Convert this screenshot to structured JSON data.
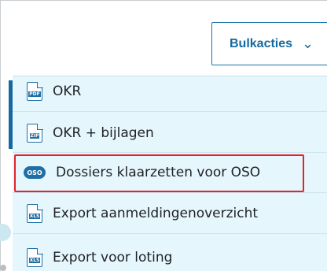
{
  "toolbar": {
    "bulk_actions_label": "Bulkacties",
    "bulk_actions_chevron": "chevron-down-icon"
  },
  "menu": {
    "items": [
      {
        "label": "OKR",
        "icon": "pdf-file-icon",
        "icon_tag": "PDF"
      },
      {
        "label": "OKR + bijlagen",
        "icon": "zip-file-icon",
        "icon_tag": "ZIP"
      },
      {
        "label": "Dossiers klaarzetten voor OSO",
        "icon": "oso-icon",
        "icon_tag": "OSO",
        "highlighted": true
      },
      {
        "label": "Export aanmeldingenoverzicht",
        "icon": "xls-file-icon",
        "icon_tag": "XLS"
      },
      {
        "label": "Export voor loting",
        "icon": "xls-file-icon",
        "icon_tag": "XLS"
      }
    ]
  },
  "colors": {
    "accent": "#1569a0",
    "menu_background": "#e6f6fd",
    "highlight_border": "#e0262a",
    "text": "#1e2125"
  }
}
